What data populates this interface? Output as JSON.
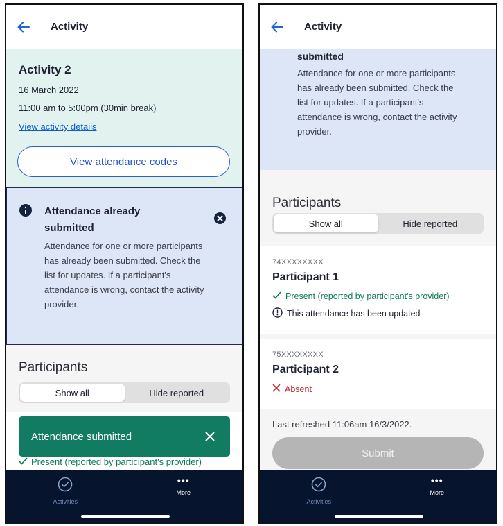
{
  "header": {
    "title": "Activity"
  },
  "activity": {
    "title": "Activity 2",
    "date": "16 March 2022",
    "time": "11:00 am to 5:00pm (30min break)",
    "details_link": "View activity details",
    "codes_button": "View attendance codes"
  },
  "alert": {
    "title": "Attendance already submitted",
    "title_scrolled": "submitted",
    "body": "Attendance for one or more participants has already been submitted. Check the list for updates. If a participant's attendance is wrong, contact the activity provider."
  },
  "participants": {
    "heading": "Participants",
    "filters": [
      "Show all",
      "Hide reported"
    ],
    "list": [
      {
        "id": "74XXXXXXXX",
        "name": "Participant 1",
        "status": "Present (reported by participant's provider)",
        "note": "This attendance has been updated"
      },
      {
        "id": "75XXXXXXXX",
        "name": "Participant 2",
        "status": "Absent"
      }
    ]
  },
  "toast": {
    "message": "Attendance submitted"
  },
  "footer": {
    "last_refreshed": "Last refreshed  11:06am 16/3/2022.",
    "submit": "Submit"
  },
  "nav": {
    "items": [
      {
        "label": "Activities",
        "icon": "check-circle-icon"
      },
      {
        "label": "More",
        "icon": "more-dots-icon"
      }
    ]
  },
  "colors": {
    "accent": "#2456c9",
    "success": "#0e7a56",
    "error": "#c4262e",
    "toast": "#127c63",
    "nav": "#07142e",
    "activity_bg": "#e2f2ee",
    "alert_bg": "#dce6f7"
  }
}
